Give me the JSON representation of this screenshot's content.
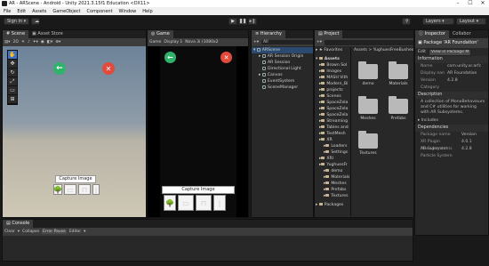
{
  "window": {
    "title": "AR - ARScene - Android - Unity 2021.3.15f1 Education <DX11>"
  },
  "menu": [
    "File",
    "Edit",
    "Assets",
    "GameObject",
    "Component",
    "Window",
    "Help"
  ],
  "toolbar": {
    "signin": "Sign in",
    "layers": "Layers",
    "layout": "Layout"
  },
  "scene": {
    "tabs": [
      "Scene",
      "Asset Store"
    ],
    "capture_label": "Capture Image"
  },
  "game": {
    "tab": "Game",
    "display_select": "Game",
    "display": "Display 1",
    "resolution": "Nova 3i (1080x2",
    "capture_label": "Capture Image"
  },
  "hierarchy": {
    "tab": "Hierarchy",
    "search_placeholder": "All",
    "scene_name": "ARScene",
    "items": [
      "AR Session Origin",
      "AR Session",
      "Directional Light",
      "Canvas",
      "EventSystem",
      "SceneManager"
    ]
  },
  "project": {
    "tab": "Project",
    "favorites": "Favorites",
    "assets_root": "Assets",
    "breadcrumb": "Assets > YughuesFreeBushes",
    "tree": [
      "Assets",
      "Brown Sol",
      "Images",
      "MASH Vith",
      "Modern_Bi",
      "projects",
      "Scenes",
      "SpaceZela",
      "SpaceZela",
      "SpaceZela",
      "Streaming",
      "Tables and",
      "TextMesh",
      "XR",
      "Loaders",
      "Settings",
      "XRI",
      "YughuesFr",
      "demo",
      "Materials",
      "Meshes",
      "Prefabs",
      "Textures",
      "Packages"
    ],
    "folders": [
      "demo",
      "Materials",
      "Meshes",
      "Prefabs",
      "Textures"
    ]
  },
  "inspector": {
    "tabs": [
      "Inspector",
      "Collabor"
    ],
    "package_title": "Package 'AR Foundation'",
    "edit": "Edit",
    "view_btn": "View in Package M",
    "info_header": "Information",
    "info": [
      {
        "k": "Name",
        "v": "com.unity.xr.arfc"
      },
      {
        "k": "Display nan",
        "v": "AR Foundation"
      },
      {
        "k": "Version",
        "v": "4.2.8"
      },
      {
        "k": "Category",
        "v": ""
      }
    ],
    "desc_header": "Description",
    "description": "A collection of MonoBehaviours and C# utilities for working with AR Subsystems.",
    "includes": "Includes",
    "deps_header": "Dependencies",
    "deps_cols": [
      "Package name",
      "Version"
    ],
    "deps": [
      {
        "k": "XR Plugin Management",
        "v": "4.0.1"
      },
      {
        "k": "AR Subsystems",
        "v": "4.2.8"
      },
      {
        "k": "Particle System",
        "v": ""
      }
    ]
  },
  "console": {
    "tab": "Console",
    "buttons": [
      "Clear",
      "Collapse",
      "Error Pause",
      "Editor"
    ]
  }
}
